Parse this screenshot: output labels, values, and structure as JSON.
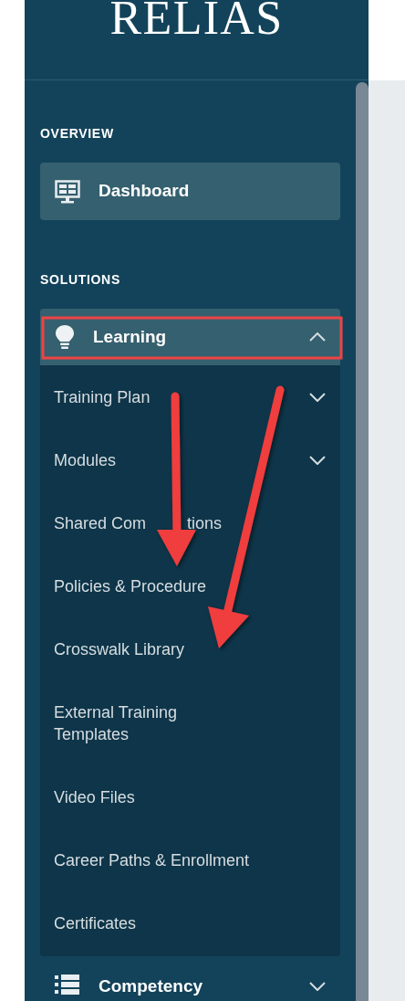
{
  "logo": "RELIAS",
  "sections": [
    {
      "heading": "OVERVIEW",
      "items": [
        {
          "label": "Dashboard"
        }
      ]
    },
    {
      "heading": "SOLUTIONS",
      "items": [
        {
          "label": "Learning",
          "expanded": true,
          "children": [
            {
              "label": "Training Plan",
              "expanded": false
            },
            {
              "label": "Modules",
              "expanded": false
            },
            {
              "label": "Shared Com",
              "label_tail": "tions"
            },
            {
              "label": "Policies & Procedure"
            },
            {
              "label": "Crosswalk Library"
            },
            {
              "label": "External Training Templates"
            },
            {
              "label": "Video Files"
            },
            {
              "label": "Career Paths & Enrollment"
            },
            {
              "label": "Certificates"
            }
          ]
        },
        {
          "label": "Competency",
          "expanded": false
        }
      ]
    }
  ]
}
